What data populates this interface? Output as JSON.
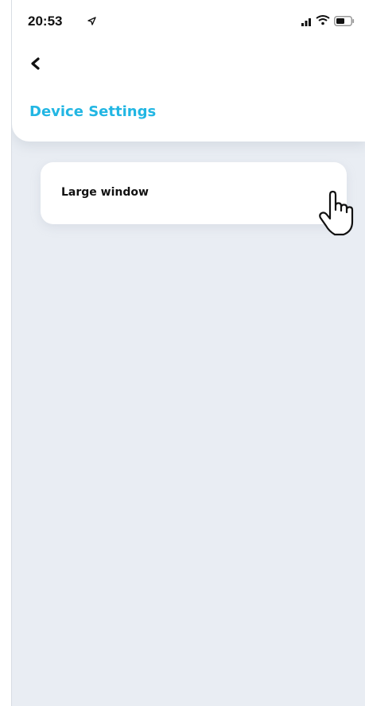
{
  "status_bar": {
    "time": "20:53",
    "icons": [
      "location-arrow-icon",
      "cellular-signal-icon",
      "wifi-icon",
      "battery-icon"
    ]
  },
  "header": {
    "back_icon": "chevron-left-icon",
    "title": "Device Settings"
  },
  "settings_list": {
    "items": [
      {
        "label": "Large window"
      }
    ]
  },
  "overlay": {
    "cursor_icon": "hand-pointer-icon"
  },
  "colors": {
    "accent": "#22b6e3",
    "background": "#e9edf3",
    "card": "#ffffff",
    "text": "#111111"
  }
}
